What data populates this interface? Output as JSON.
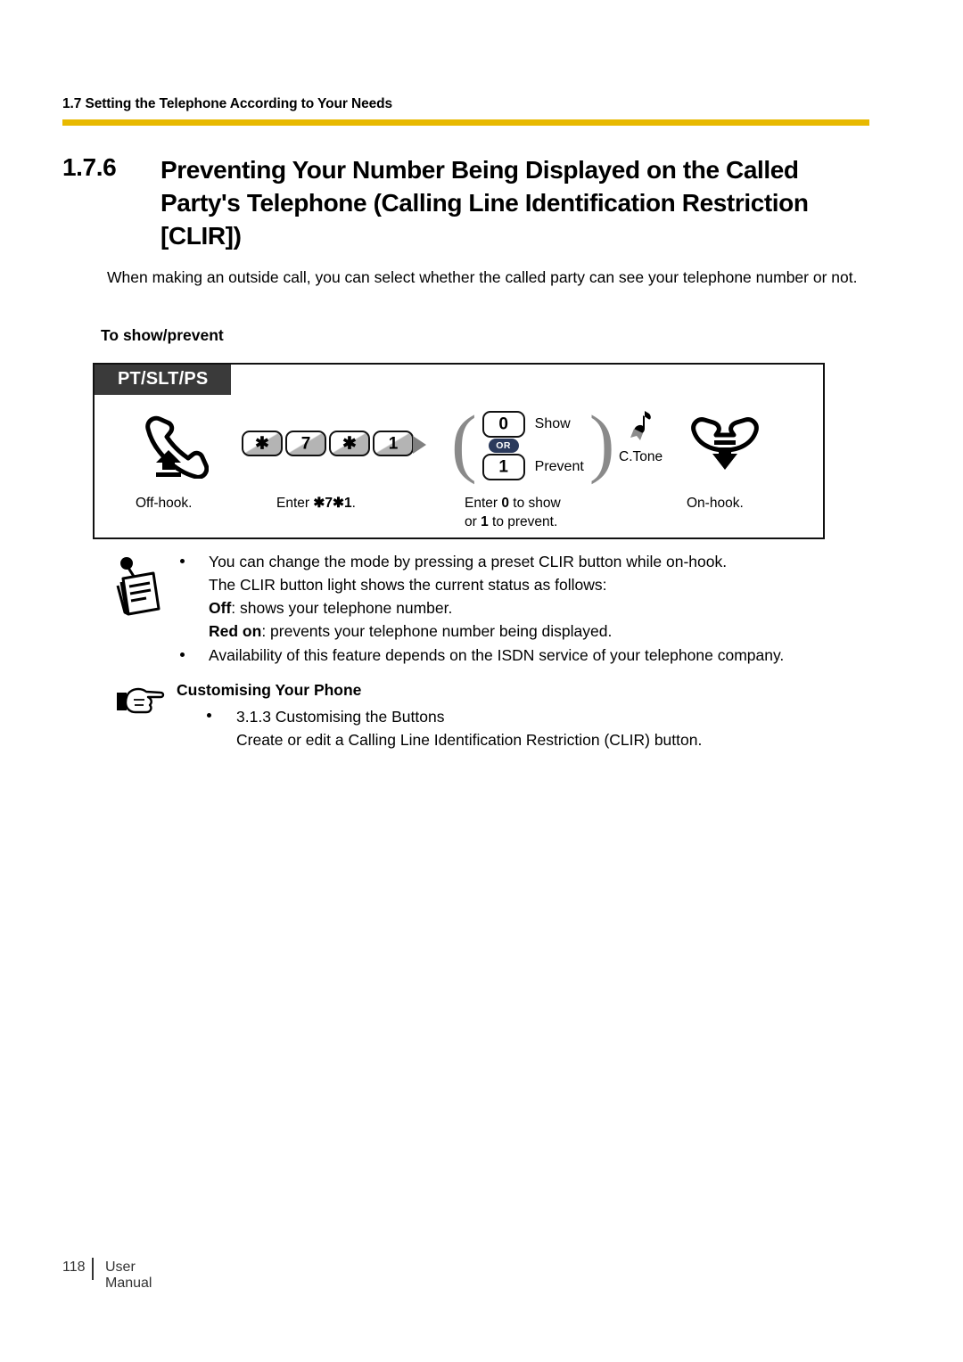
{
  "header": {
    "running_head": "1.7 Setting the Telephone According to Your Needs",
    "rule_color": "#e8b900"
  },
  "section": {
    "number": "1.7.6",
    "title": "Preventing Your Number Being Displayed on the Called Party's Telephone (Calling Line Identification Restriction [CLIR])"
  },
  "intro": "When making an outside call, you can select whether the called party can see your telephone number or not.",
  "subheading": "To show/prevent",
  "diagram": {
    "badge": "PT/SLT/PS",
    "badge_bg": "#3a3a3a",
    "steps": {
      "offhook_icon": "handset-offhook-icon",
      "keys": [
        "✱",
        "7",
        "✱",
        "1"
      ],
      "option_keys": [
        {
          "key": "0",
          "label": "Show"
        },
        {
          "key": "1",
          "label": "Prevent"
        }
      ],
      "or_badge": "OR",
      "or_badge_color": "#2b3a5c",
      "tone_label": "C.Tone",
      "onhook_icon": "handset-onhook-icon"
    },
    "captions": {
      "offhook": "Off-hook.",
      "enter_code_prefix": "Enter ",
      "enter_code_value": "✱7✱1",
      "enter_code_suffix": ".",
      "option_line1_a": "Enter ",
      "option_line1_b": "0",
      "option_line1_c": " to show",
      "option_line2_a": "or ",
      "option_line2_b": "1",
      "option_line2_c": " to prevent.",
      "onhook": "On-hook."
    }
  },
  "notes": {
    "icon": "memo-note-icon",
    "items": [
      {
        "lines": [
          {
            "text": "You can change the mode by pressing a preset CLIR button while on-hook."
          },
          {
            "text": "The CLIR button light shows the current status as follows:"
          },
          {
            "bold": "Off",
            "text": ": shows your telephone number."
          },
          {
            "bold": "Red on",
            "text": ": prevents your telephone number being displayed."
          }
        ]
      },
      {
        "lines": [
          {
            "text": "Availability of this feature depends on the ISDN service of your telephone company."
          }
        ]
      }
    ]
  },
  "customising": {
    "icon": "pointing-hand-icon",
    "title": "Customising Your Phone",
    "bullet_line": "3.1.3 Customising the Buttons",
    "description": "Create or edit a Calling Line Identification Restriction (CLIR) button."
  },
  "footer": {
    "page_number": "118",
    "label": "User Manual"
  }
}
